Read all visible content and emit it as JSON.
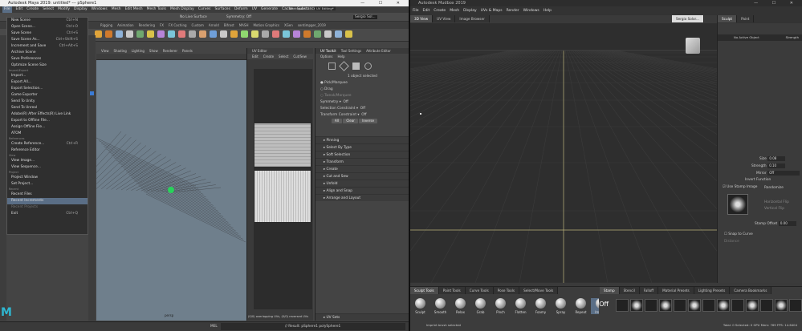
{
  "maya": {
    "title": "Autodesk Maya 2019: untitled*  ---  pSphere1",
    "menus": [
      "File",
      "Edit",
      "Create",
      "Select",
      "Modify",
      "Display",
      "Windows",
      "Mesh",
      "Edit Mesh",
      "Mesh Tools",
      "Mesh Display",
      "Curves",
      "Surfaces",
      "Deform",
      "UV",
      "Generate",
      "Cache",
      "Substance"
    ],
    "workspace_label": "Workspace :",
    "workspace_value": "UV Editing*",
    "status": {
      "no_live_surface": "No Live Surface",
      "symmetry": "Symmetry: Off",
      "user": "Sergio Sol..."
    },
    "shelf_tabs": [
      "Rigging",
      "Animation",
      "Rendering",
      "FX",
      "FX Caching",
      "Custom",
      "Arnold",
      "Bifrost",
      "MASH",
      "Motion Graphics",
      "XGen",
      "sentimpger_2019"
    ],
    "file_menu": {
      "items": [
        {
          "type": "item",
          "label": "New Scene",
          "shortcut": "Ctrl+N"
        },
        {
          "type": "item",
          "label": "Open Scene...",
          "shortcut": "Ctrl+O"
        },
        {
          "type": "item",
          "label": "Save Scene",
          "shortcut": "Ctrl+S"
        },
        {
          "type": "item",
          "label": "Save Scene As...",
          "shortcut": "Ctrl+Shift+S"
        },
        {
          "type": "item",
          "label": "Increment and Save",
          "shortcut": "Ctrl+Alt+S"
        },
        {
          "type": "item",
          "label": "Archive Scene",
          "shortcut": ""
        },
        {
          "type": "item",
          "label": "Save Preferences",
          "shortcut": ""
        },
        {
          "type": "item",
          "label": "Optimize Scene Size",
          "shortcut": ""
        },
        {
          "type": "sec",
          "label": "Import/Export"
        },
        {
          "type": "item",
          "label": "Import...",
          "shortcut": ""
        },
        {
          "type": "item",
          "label": "Export All...",
          "shortcut": ""
        },
        {
          "type": "item",
          "label": "Export Selection...",
          "shortcut": ""
        },
        {
          "type": "item",
          "label": "Game Exporter",
          "shortcut": ""
        },
        {
          "type": "item",
          "label": "Send To Unity",
          "shortcut": ""
        },
        {
          "type": "item",
          "label": "Send To Unreal",
          "shortcut": ""
        },
        {
          "type": "item",
          "label": "Adobe(R) After Effects(R) Live Link",
          "shortcut": ""
        },
        {
          "type": "item",
          "label": "Export to Offline File...",
          "shortcut": ""
        },
        {
          "type": "item",
          "label": "Assign Offline File...",
          "shortcut": ""
        },
        {
          "type": "item",
          "label": "ATOM",
          "shortcut": ""
        },
        {
          "type": "sec",
          "label": "References"
        },
        {
          "type": "item",
          "label": "Create Reference...",
          "shortcut": "Ctrl+R"
        },
        {
          "type": "item",
          "label": "Reference Editor",
          "shortcut": ""
        },
        {
          "type": "sec",
          "label": "View"
        },
        {
          "type": "item",
          "label": "View Image...",
          "shortcut": ""
        },
        {
          "type": "item",
          "label": "View Sequence...",
          "shortcut": ""
        },
        {
          "type": "sec",
          "label": "Project"
        },
        {
          "type": "item",
          "label": "Project Window",
          "shortcut": ""
        },
        {
          "type": "item",
          "label": "Set Project...",
          "shortcut": ""
        },
        {
          "type": "sec",
          "label": "Recent"
        },
        {
          "type": "item",
          "label": "Recent Files",
          "shortcut": ""
        },
        {
          "type": "hi",
          "label": "Recent Increments",
          "shortcut": ""
        },
        {
          "type": "dis",
          "label": "Recent Projects",
          "shortcut": ""
        },
        {
          "type": "item",
          "label": "Exit",
          "shortcut": "Ctrl+Q"
        }
      ]
    },
    "viewport": {
      "menus": [
        "View",
        "Shading",
        "Lighting",
        "Show",
        "Renderer",
        "Panels"
      ],
      "camera": "persp"
    },
    "uv_editor": {
      "title": "UV Editor",
      "menus": [
        "Edit",
        "Create",
        "Select",
        "Cut/Sew"
      ],
      "status": "(0/0) overlapping UVs, (0/0) reversed UVs"
    },
    "uv_toolkit": {
      "tabs": [
        "UV Toolkit",
        "Tool Settings",
        "Attribute Editor"
      ],
      "menus": [
        "Options",
        "Help"
      ],
      "selected": "1 object selected",
      "pick_marquee": "Pick/Marquee",
      "drag": "Drag",
      "tweak": "Tweak/Marquee",
      "symmetry": "Symmetry",
      "symmetry_val": "Off",
      "selection_constraint": "Selection Constraint",
      "sc_val": "Off",
      "transform_constraint": "Transform Constraint",
      "tc_val": "Off",
      "btn_all": "All",
      "btn_clear": "Clear",
      "btn_inverse": "Inverse",
      "sections": [
        "Pinning",
        "Select By Type",
        "Soft Selection",
        "Transform",
        "Create",
        "Cut and Sew",
        "Unfold",
        "Align and Snap",
        "Arrange and Layout"
      ],
      "footer": "UV Sets"
    },
    "bottom": {
      "mel": "MEL",
      "result": "// Result: pSphere1 polySphere1"
    }
  },
  "mudbox": {
    "title": "Autodesk Mudbox 2019",
    "menus": [
      "File",
      "Edit",
      "Create",
      "Mesh",
      "Display",
      "UVs & Maps",
      "Render",
      "Windows",
      "Help"
    ],
    "view_tabs": [
      "3D View",
      "UV View",
      "Image Browser"
    ],
    "user": "Sergio Solor...",
    "right_tabs": [
      "Sculpt",
      "Paint"
    ],
    "layer_row": {
      "name": "No Active Object",
      "col": "Strength"
    },
    "props": {
      "size_label": "Size",
      "size": "0.08",
      "strength_label": "Strength",
      "strength": "0.10",
      "mirror_label": "Mirror",
      "mirror": "Off",
      "invert_function": "Invert Function",
      "use_stamp_image": "Use Stamp Image",
      "randomize": "Randomize",
      "horizontal_flip": "Horizontal Flip",
      "vertical_flip": "Vertical Flip",
      "stamp_offset_label": "Stamp Offset",
      "stamp_offset": "0.00",
      "snap_to_curve": "Snap to Curve",
      "distance": "Distance"
    },
    "tool_tabs": [
      "Sculpt Tools",
      "Paint Tools",
      "Curve Tools",
      "Pose Tools",
      "Select/Move Tools"
    ],
    "tools": [
      "Sculpt",
      "Smooth",
      "Relax",
      "Grab",
      "Pinch",
      "Flatten",
      "Foamy",
      "Spray",
      "Repeat",
      "Imprint"
    ],
    "stamp_tabs": [
      "Stamp",
      "Stencil",
      "Falloff",
      "Material Presets",
      "Lighting Presets",
      "Camera Bookmarks"
    ],
    "stamp_off": "Off",
    "status_left": "Imprint brush selected",
    "status_right": "Total: 0  Selected: 0  GPU Mem: 769  FPS: 14.6404"
  }
}
